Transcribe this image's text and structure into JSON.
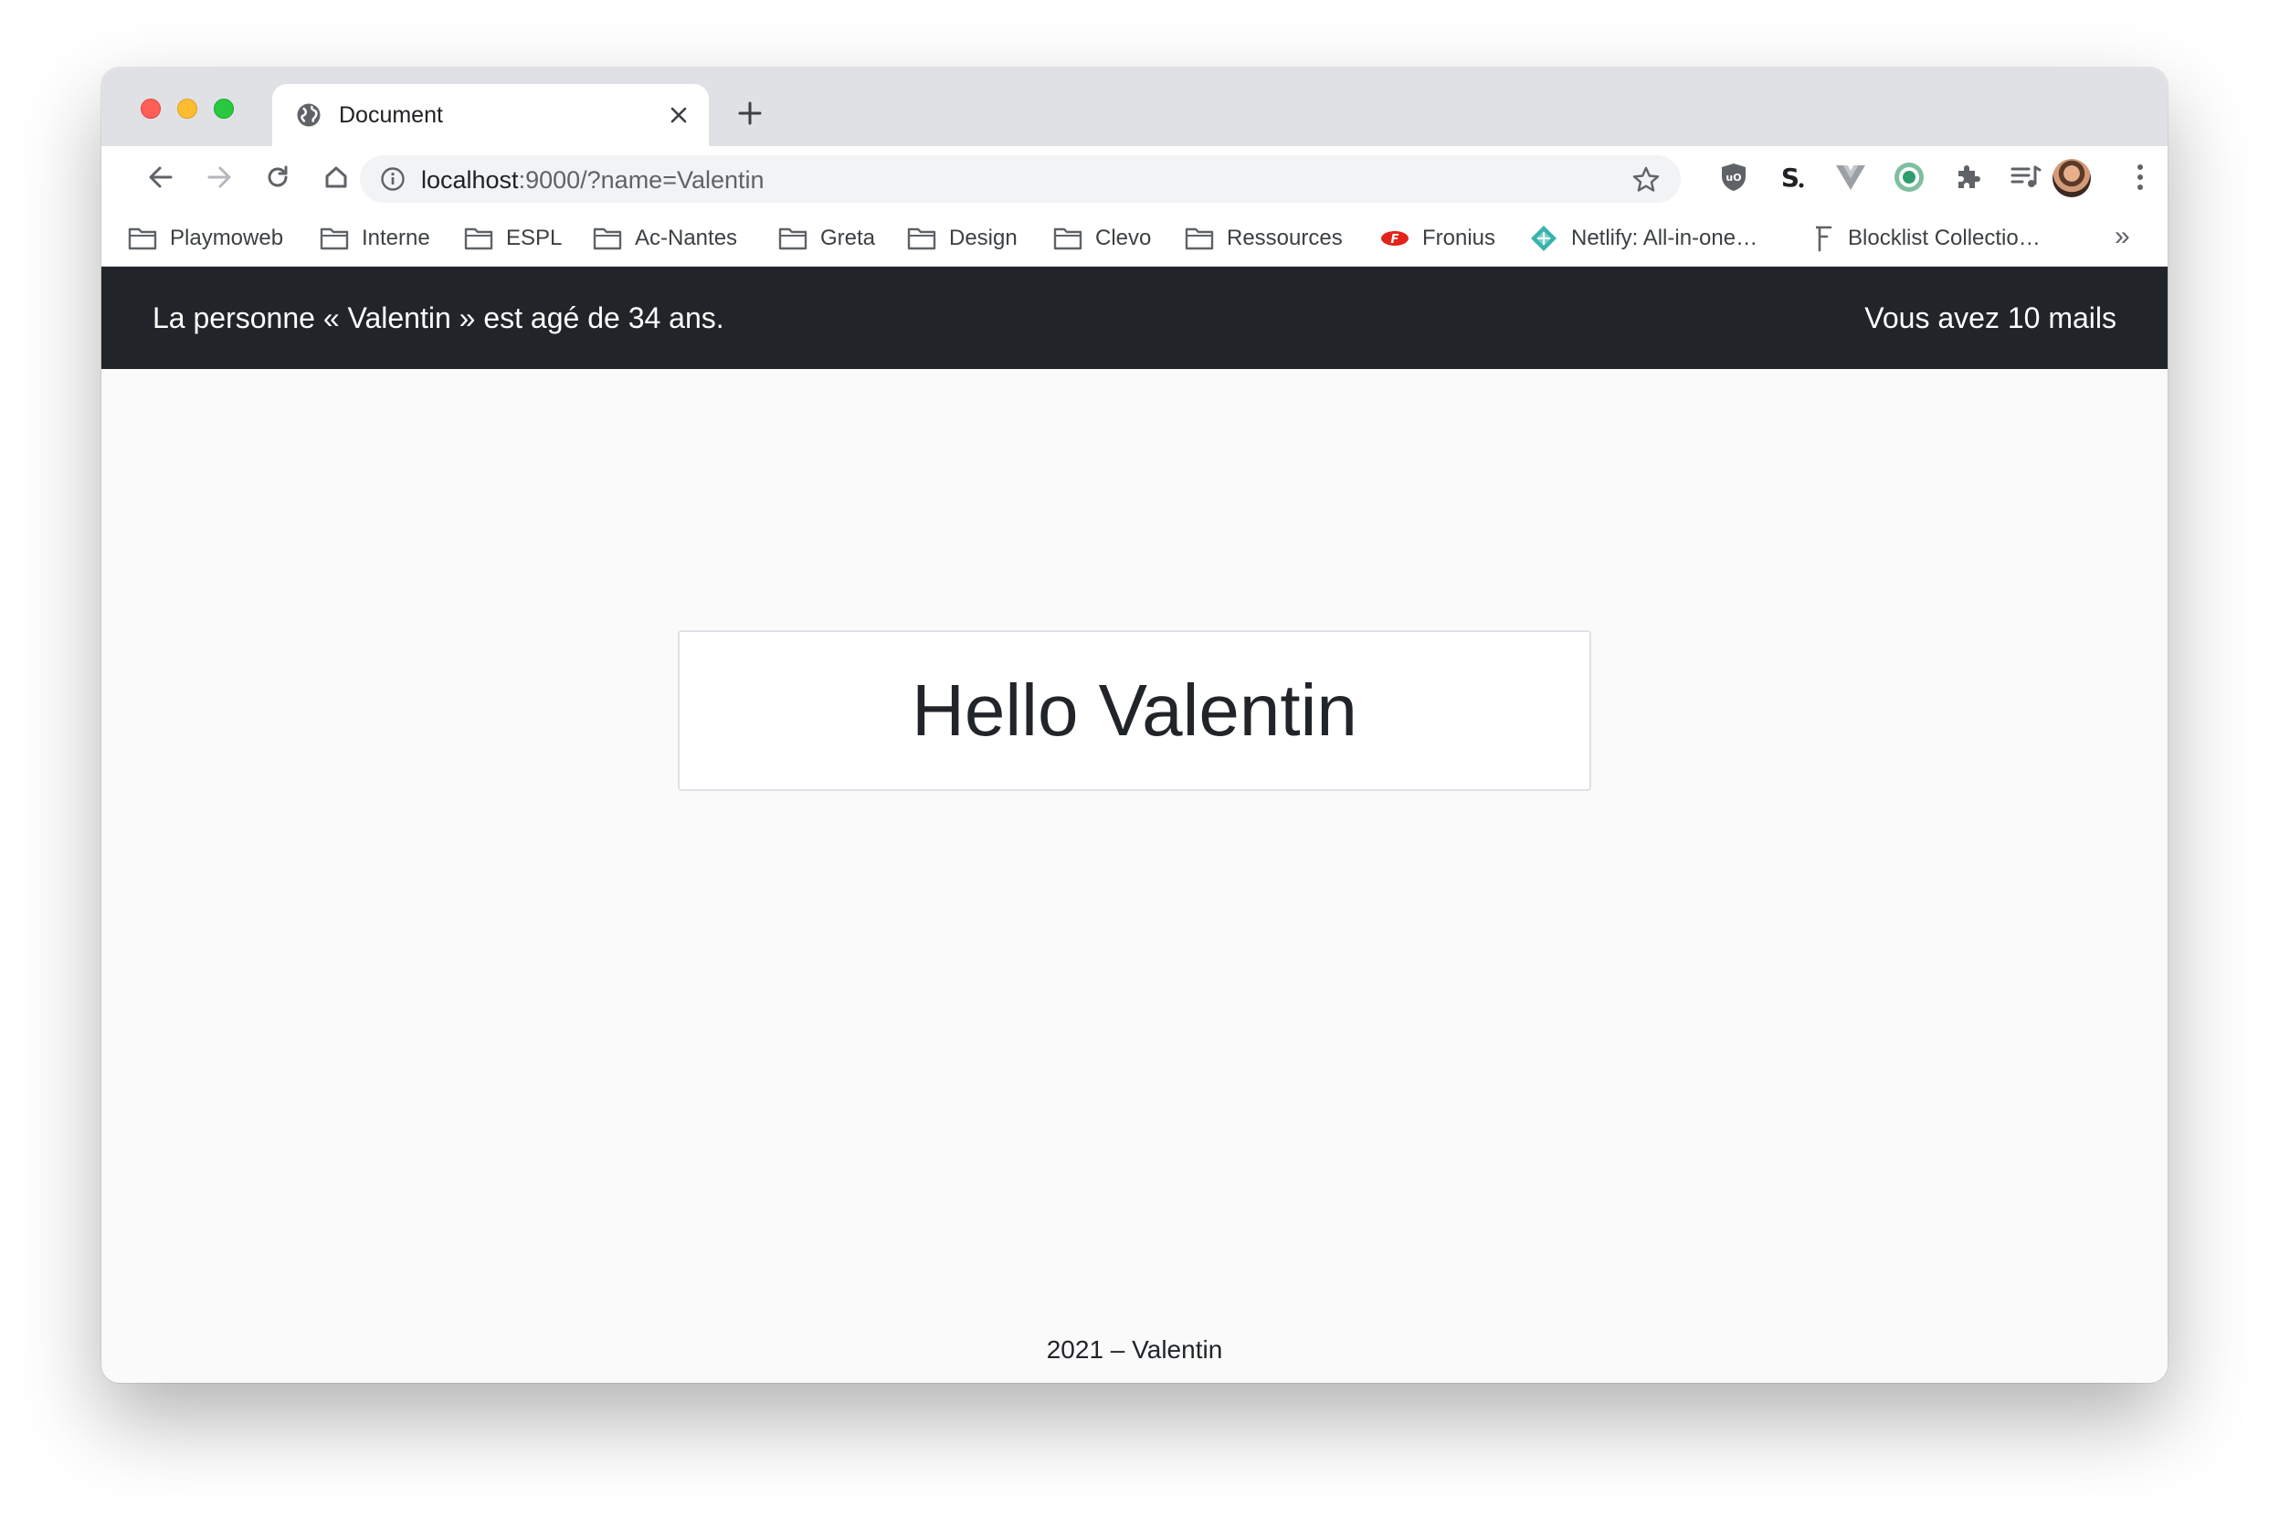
{
  "browser": {
    "tab": {
      "title": "Document"
    },
    "address_bar": {
      "host": "localhost",
      "path": ":9000/?name=Valentin"
    },
    "bookmarks": [
      {
        "label": "Playmoweb",
        "icon": "folder-icon"
      },
      {
        "label": "Interne",
        "icon": "folder-icon"
      },
      {
        "label": "ESPL",
        "icon": "folder-icon"
      },
      {
        "label": "Ac-Nantes",
        "icon": "folder-icon"
      },
      {
        "label": "Greta",
        "icon": "folder-icon"
      },
      {
        "label": "Design",
        "icon": "folder-icon"
      },
      {
        "label": "Clevo",
        "icon": "folder-icon"
      },
      {
        "label": "Ressources",
        "icon": "folder-icon"
      },
      {
        "label": "Fronius",
        "icon": "fronius-logo-icon"
      },
      {
        "label": "Netlify: All-in-one…",
        "icon": "netlify-logo-icon"
      },
      {
        "label": "Blocklist Collectio…",
        "icon": "blocklist-logo-icon"
      }
    ],
    "more_bookmarks": "»",
    "colors": {
      "tabstrip": "#dfe1e5",
      "omnibox": "#f1f3f4"
    }
  },
  "page": {
    "header": {
      "person_text": "La personne « Valentin » est agé de 34 ans.",
      "mail_text": "Vous avez 10 mails"
    },
    "greeting": "Hello Valentin",
    "footer": "2021 – Valentin",
    "colors": {
      "header_bg": "#212529",
      "page_bg": "#fafafa"
    }
  }
}
